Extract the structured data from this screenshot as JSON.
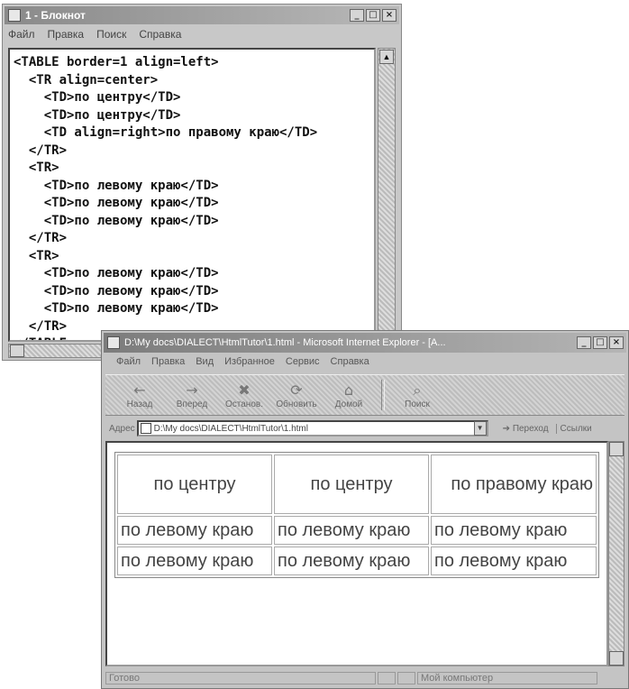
{
  "notepad": {
    "title": "1 - Блокнот",
    "menu": [
      "Файл",
      "Правка",
      "Поиск",
      "Справка"
    ],
    "code_lines": [
      "<TABLE border=1 align=left>",
      "  <TR align=center>",
      "    <TD>по центру</TD>",
      "    <TD>по центру</TD>",
      "    <TD align=right>по правому краю</TD>",
      "  </TR>",
      "  <TR>",
      "    <TD>по левому краю</TD>",
      "    <TD>по левому краю</TD>",
      "    <TD>по левому краю</TD>",
      "  </TR>",
      "  <TR>",
      "    <TD>по левому краю</TD>",
      "    <TD>по левому краю</TD>",
      "    <TD>по левому краю</TD>",
      "  </TR>",
      "</TABLE>"
    ]
  },
  "browser": {
    "title": "D:\\My docs\\DIALECT\\HtmlTutor\\1.html - Microsoft Internet Explorer - [A...",
    "menu": [
      "Файл",
      "Правка",
      "Вид",
      "Избранное",
      "Сервис",
      "Справка"
    ],
    "toolbar": [
      {
        "label": "Назад",
        "icon": "back-arrow-icon",
        "glyph": "←"
      },
      {
        "label": "Вперед",
        "icon": "forward-arrow-icon",
        "glyph": "→"
      },
      {
        "label": "Останов.",
        "icon": "stop-icon",
        "glyph": "✖"
      },
      {
        "label": "Обновить",
        "icon": "refresh-icon",
        "glyph": "⟳"
      },
      {
        "label": "Домой",
        "icon": "home-icon",
        "glyph": "⌂"
      },
      {
        "label": "Поиск",
        "icon": "search-icon",
        "glyph": "⌕"
      }
    ],
    "address_label": "Адрес",
    "address_value": "D:\\My docs\\DIALECT\\HtmlTutor\\1.html",
    "go_label": "Переход",
    "links_label": "Ссылки",
    "status_text": "Готово",
    "zone_text": "Мой компьютер",
    "table": {
      "rows": [
        [
          "по центру",
          "по центру",
          "по правому краю"
        ],
        [
          "по левому краю",
          "по левому краю",
          "по левому краю"
        ],
        [
          "по левому краю",
          "по левому краю",
          "по левому краю"
        ]
      ]
    }
  }
}
